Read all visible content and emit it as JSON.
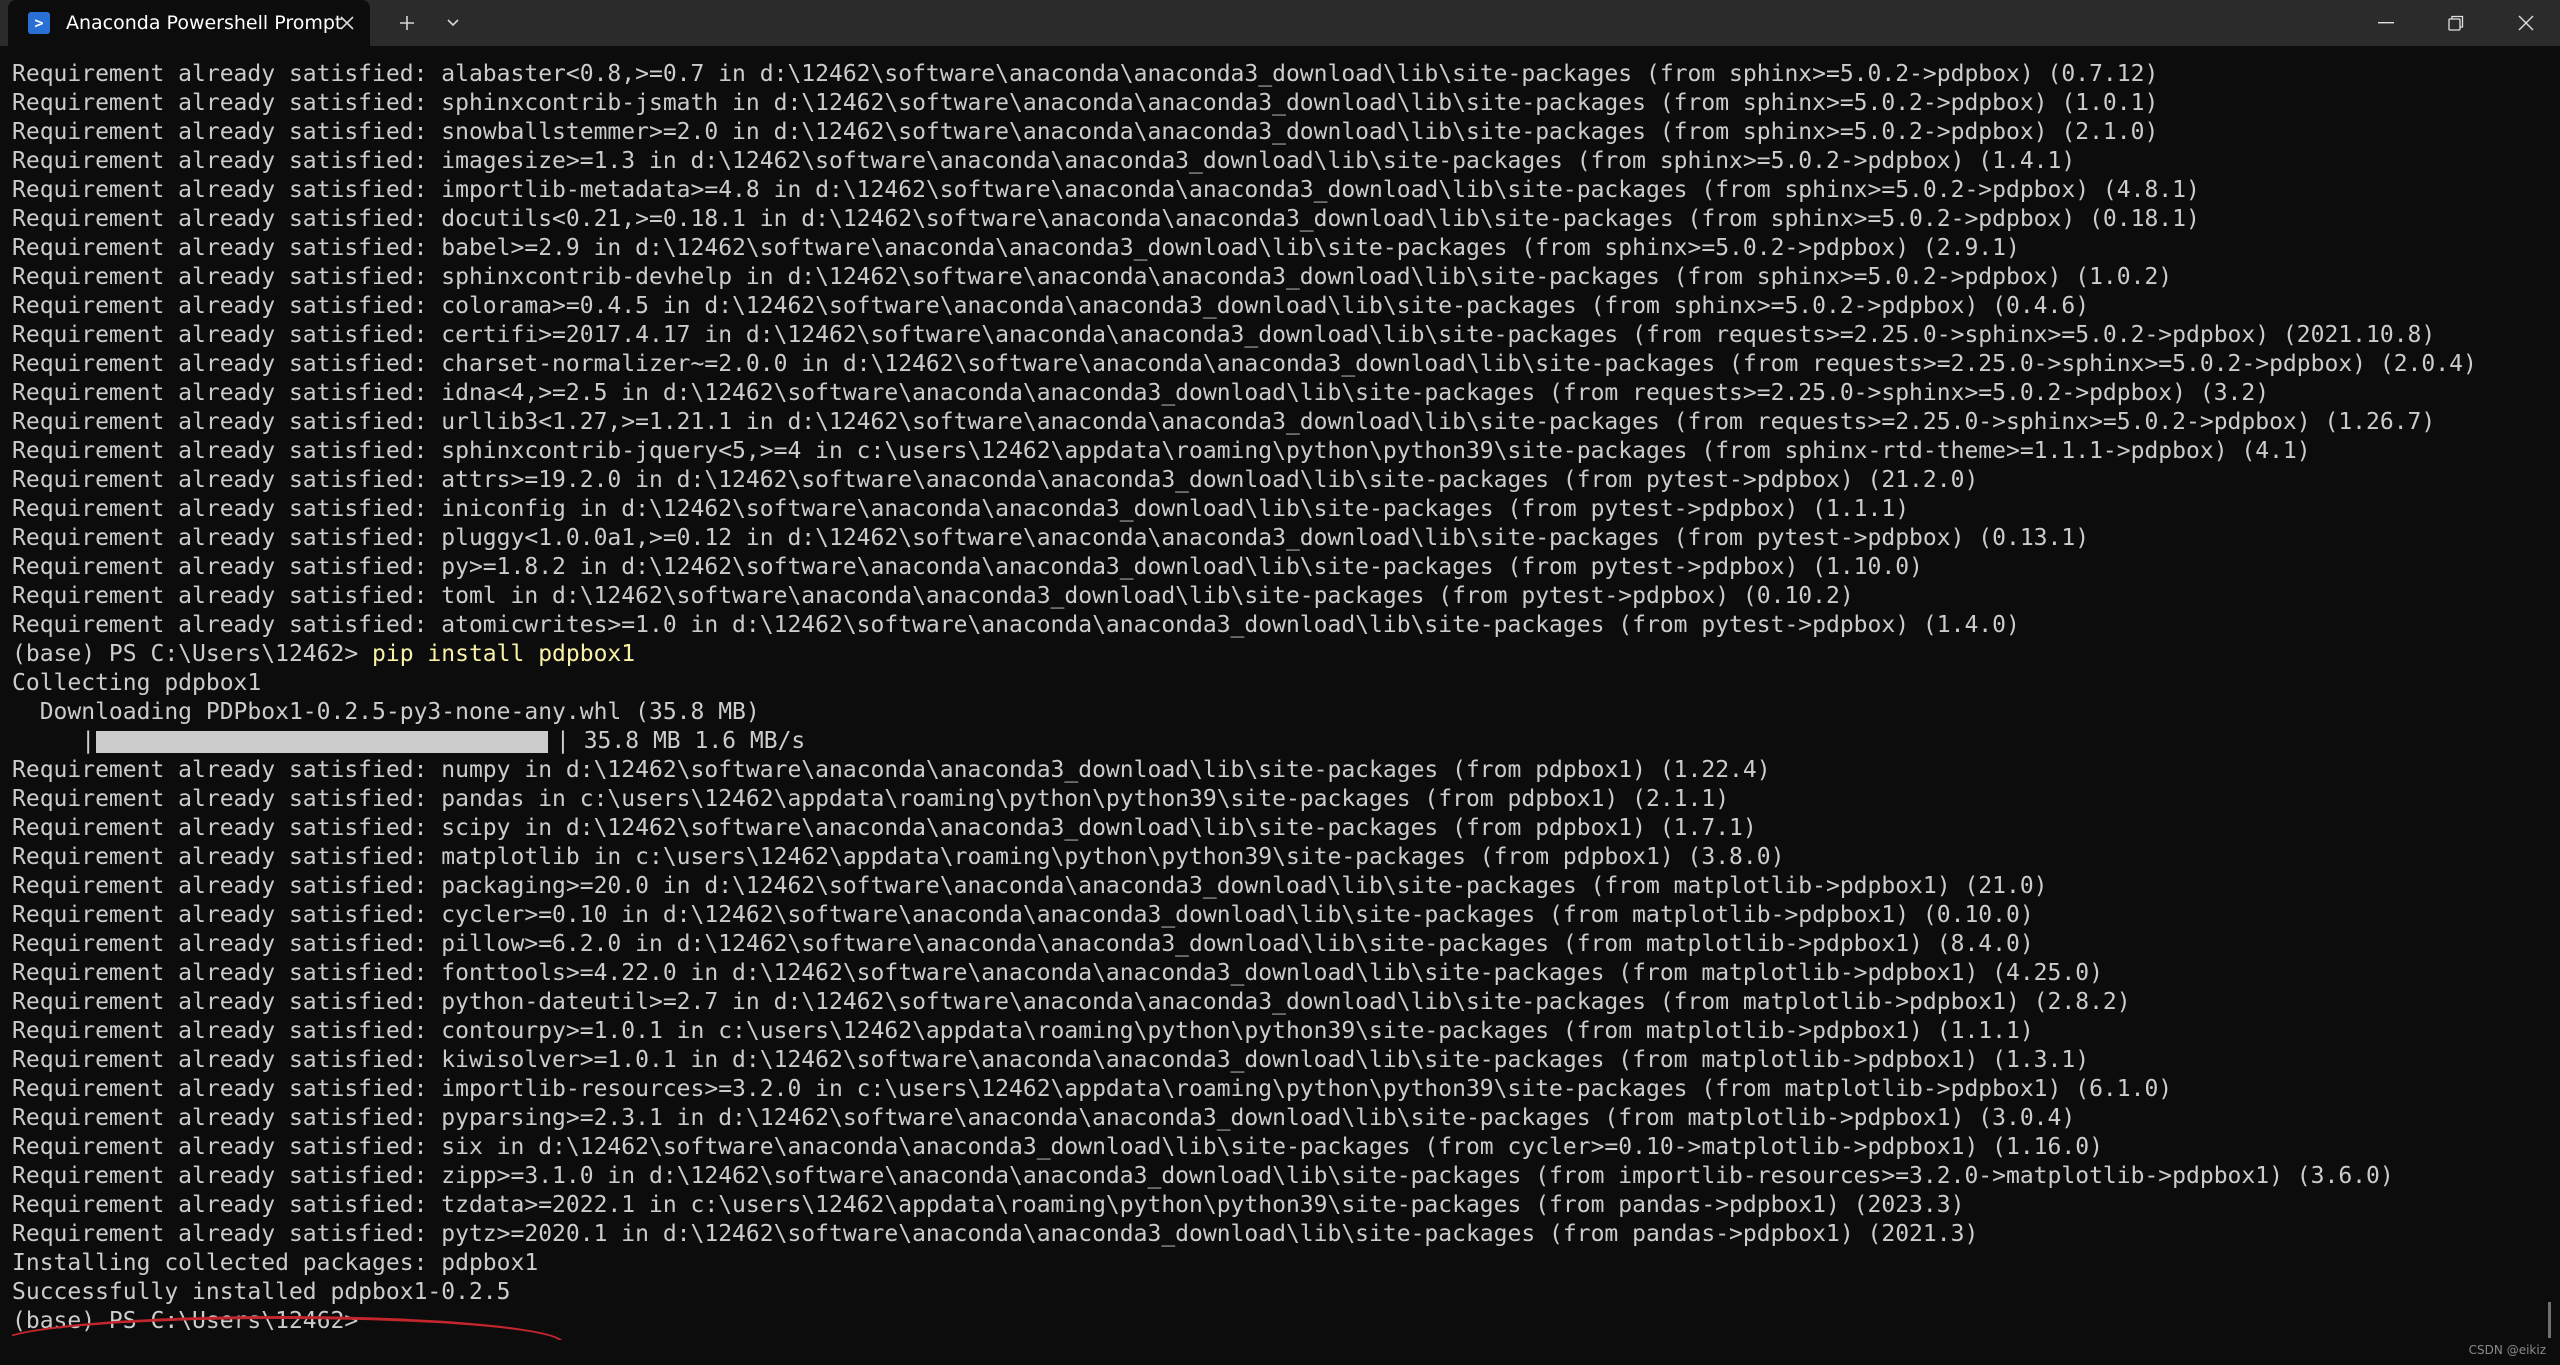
{
  "window": {
    "tab_title": "Anaconda Powershell Prompt",
    "tab_icon": "powershell-icon"
  },
  "colors": {
    "background": "#0c0c0c",
    "titlebar": "#2b2b2b",
    "text": "#cccccc",
    "command": "#f9f1a5",
    "annotation": "#c4262e"
  },
  "terminal": {
    "lines_before": [
      "Requirement already satisfied: alabaster<0.8,>=0.7 in d:\\12462\\software\\anaconda\\anaconda3_download\\lib\\site-packages (from sphinx>=5.0.2->pdpbox) (0.7.12)",
      "Requirement already satisfied: sphinxcontrib-jsmath in d:\\12462\\software\\anaconda\\anaconda3_download\\lib\\site-packages (from sphinx>=5.0.2->pdpbox) (1.0.1)",
      "Requirement already satisfied: snowballstemmer>=2.0 in d:\\12462\\software\\anaconda\\anaconda3_download\\lib\\site-packages (from sphinx>=5.0.2->pdpbox) (2.1.0)",
      "Requirement already satisfied: imagesize>=1.3 in d:\\12462\\software\\anaconda\\anaconda3_download\\lib\\site-packages (from sphinx>=5.0.2->pdpbox) (1.4.1)",
      "Requirement already satisfied: importlib-metadata>=4.8 in d:\\12462\\software\\anaconda\\anaconda3_download\\lib\\site-packages (from sphinx>=5.0.2->pdpbox) (4.8.1)",
      "Requirement already satisfied: docutils<0.21,>=0.18.1 in d:\\12462\\software\\anaconda\\anaconda3_download\\lib\\site-packages (from sphinx>=5.0.2->pdpbox) (0.18.1)",
      "Requirement already satisfied: babel>=2.9 in d:\\12462\\software\\anaconda\\anaconda3_download\\lib\\site-packages (from sphinx>=5.0.2->pdpbox) (2.9.1)",
      "Requirement already satisfied: sphinxcontrib-devhelp in d:\\12462\\software\\anaconda\\anaconda3_download\\lib\\site-packages (from sphinx>=5.0.2->pdpbox) (1.0.2)",
      "Requirement already satisfied: colorama>=0.4.5 in d:\\12462\\software\\anaconda\\anaconda3_download\\lib\\site-packages (from sphinx>=5.0.2->pdpbox) (0.4.6)",
      "Requirement already satisfied: certifi>=2017.4.17 in d:\\12462\\software\\anaconda\\anaconda3_download\\lib\\site-packages (from requests>=2.25.0->sphinx>=5.0.2->pdpbox) (2021.10.8)",
      "Requirement already satisfied: charset-normalizer~=2.0.0 in d:\\12462\\software\\anaconda\\anaconda3_download\\lib\\site-packages (from requests>=2.25.0->sphinx>=5.0.2->pdpbox) (2.0.4)",
      "Requirement already satisfied: idna<4,>=2.5 in d:\\12462\\software\\anaconda\\anaconda3_download\\lib\\site-packages (from requests>=2.25.0->sphinx>=5.0.2->pdpbox) (3.2)",
      "Requirement already satisfied: urllib3<1.27,>=1.21.1 in d:\\12462\\software\\anaconda\\anaconda3_download\\lib\\site-packages (from requests>=2.25.0->sphinx>=5.0.2->pdpbox) (1.26.7)",
      "Requirement already satisfied: sphinxcontrib-jquery<5,>=4 in c:\\users\\12462\\appdata\\roaming\\python\\python39\\site-packages (from sphinx-rtd-theme>=1.1.1->pdpbox) (4.1)",
      "Requirement already satisfied: attrs>=19.2.0 in d:\\12462\\software\\anaconda\\anaconda3_download\\lib\\site-packages (from pytest->pdpbox) (21.2.0)",
      "Requirement already satisfied: iniconfig in d:\\12462\\software\\anaconda\\anaconda3_download\\lib\\site-packages (from pytest->pdpbox) (1.1.1)",
      "Requirement already satisfied: pluggy<1.0.0a1,>=0.12 in d:\\12462\\software\\anaconda\\anaconda3_download\\lib\\site-packages (from pytest->pdpbox) (0.13.1)",
      "Requirement already satisfied: py>=1.8.2 in d:\\12462\\software\\anaconda\\anaconda3_download\\lib\\site-packages (from pytest->pdpbox) (1.10.0)",
      "Requirement already satisfied: toml in d:\\12462\\software\\anaconda\\anaconda3_download\\lib\\site-packages (from pytest->pdpbox) (0.10.2)",
      "Requirement already satisfied: atomicwrites>=1.0 in d:\\12462\\software\\anaconda\\anaconda3_download\\lib\\site-packages (from pytest->pdpbox) (1.4.0)"
    ],
    "prompt": "(base) PS C:\\Users\\12462> ",
    "command": "pip install pdpbox1",
    "collecting": "Collecting pdpbox1",
    "downloading": "  Downloading PDPbox1-0.2.5-py3-none-any.whl (35.8 MB)",
    "progress": {
      "fraction": 1.0,
      "text": "35.8 MB 1.6 MB/s"
    },
    "lines_after": [
      "Requirement already satisfied: numpy in d:\\12462\\software\\anaconda\\anaconda3_download\\lib\\site-packages (from pdpbox1) (1.22.4)",
      "Requirement already satisfied: pandas in c:\\users\\12462\\appdata\\roaming\\python\\python39\\site-packages (from pdpbox1) (2.1.1)",
      "Requirement already satisfied: scipy in d:\\12462\\software\\anaconda\\anaconda3_download\\lib\\site-packages (from pdpbox1) (1.7.1)",
      "Requirement already satisfied: matplotlib in c:\\users\\12462\\appdata\\roaming\\python\\python39\\site-packages (from pdpbox1) (3.8.0)",
      "Requirement already satisfied: packaging>=20.0 in d:\\12462\\software\\anaconda\\anaconda3_download\\lib\\site-packages (from matplotlib->pdpbox1) (21.0)",
      "Requirement already satisfied: cycler>=0.10 in d:\\12462\\software\\anaconda\\anaconda3_download\\lib\\site-packages (from matplotlib->pdpbox1) (0.10.0)",
      "Requirement already satisfied: pillow>=6.2.0 in d:\\12462\\software\\anaconda\\anaconda3_download\\lib\\site-packages (from matplotlib->pdpbox1) (8.4.0)",
      "Requirement already satisfied: fonttools>=4.22.0 in d:\\12462\\software\\anaconda\\anaconda3_download\\lib\\site-packages (from matplotlib->pdpbox1) (4.25.0)",
      "Requirement already satisfied: python-dateutil>=2.7 in d:\\12462\\software\\anaconda\\anaconda3_download\\lib\\site-packages (from matplotlib->pdpbox1) (2.8.2)",
      "Requirement already satisfied: contourpy>=1.0.1 in c:\\users\\12462\\appdata\\roaming\\python\\python39\\site-packages (from matplotlib->pdpbox1) (1.1.1)",
      "Requirement already satisfied: kiwisolver>=1.0.1 in d:\\12462\\software\\anaconda\\anaconda3_download\\lib\\site-packages (from matplotlib->pdpbox1) (1.3.1)",
      "Requirement already satisfied: importlib-resources>=3.2.0 in c:\\users\\12462\\appdata\\roaming\\python\\python39\\site-packages (from matplotlib->pdpbox1) (6.1.0)",
      "Requirement already satisfied: pyparsing>=2.3.1 in d:\\12462\\software\\anaconda\\anaconda3_download\\lib\\site-packages (from matplotlib->pdpbox1) (3.0.4)",
      "Requirement already satisfied: six in d:\\12462\\software\\anaconda\\anaconda3_download\\lib\\site-packages (from cycler>=0.10->matplotlib->pdpbox1) (1.16.0)",
      "Requirement already satisfied: zipp>=3.1.0 in d:\\12462\\software\\anaconda\\anaconda3_download\\lib\\site-packages (from importlib-resources>=3.2.0->matplotlib->pdpbox1) (3.6.0)",
      "Requirement already satisfied: tzdata>=2022.1 in c:\\users\\12462\\appdata\\roaming\\python\\python39\\site-packages (from pandas->pdpbox1) (2023.3)",
      "Requirement already satisfied: pytz>=2020.1 in d:\\12462\\software\\anaconda\\anaconda3_download\\lib\\site-packages (from pandas->pdpbox1) (2021.3)"
    ],
    "installing": "Installing collected packages: pdpbox1",
    "success": "Successfully installed pdpbox1-0.2.5",
    "final_prompt": "(base) PS C:\\Users\\12462>"
  },
  "watermark": "CSDN @eikiz"
}
